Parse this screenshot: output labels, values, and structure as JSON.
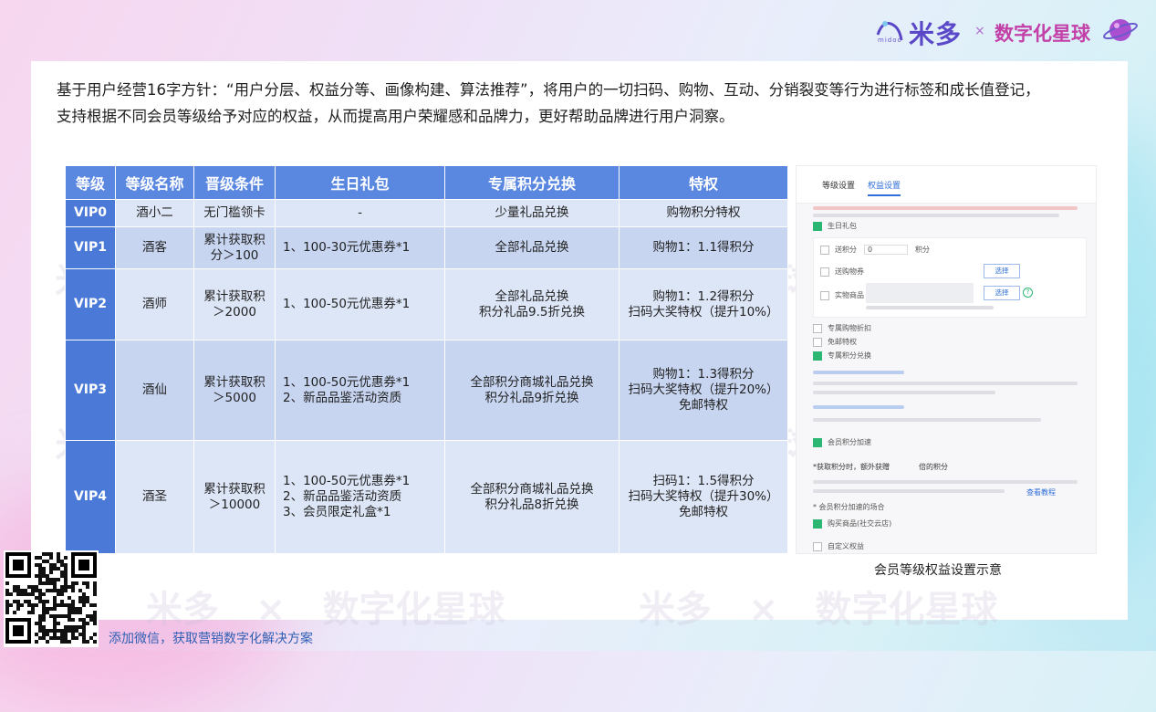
{
  "brand": {
    "logo_text": "米多",
    "logo_sub": "midoo",
    "separator": "×",
    "partner": "数字化星球"
  },
  "intro": {
    "line1": "基于用户经营16字方针：“用户分层、权益分等、画像构建、算法推荐”，将用户的一切扫码、购物、互动、分销裂变等行为进行标签和成长值登记，",
    "line2": "支持根据不同会员等级给予对应的权益，从而提高用户荣耀感和品牌力，更好帮助品牌进行用户洞察。"
  },
  "table": {
    "headers": [
      "等级",
      "等级名称",
      "晋级条件",
      "生日礼包",
      "专属积分兑换",
      "特权"
    ],
    "rows": [
      {
        "level": "VIP0",
        "name": "酒小二",
        "cond": [
          "无门槛领卡"
        ],
        "gift": [
          "-"
        ],
        "points": [
          "少量礼品兑换"
        ],
        "privilege": [
          "购物积分特权"
        ]
      },
      {
        "level": "VIP1",
        "name": "酒客",
        "cond": [
          "累计获取积",
          "分＞100"
        ],
        "gift": [
          "1、100-30元优惠券*1"
        ],
        "points": [
          "全部礼品兑换"
        ],
        "privilege": [
          "购物1：1.1得积分"
        ]
      },
      {
        "level": "VIP2",
        "name": "酒师",
        "cond": [
          "累计获取积",
          "＞2000"
        ],
        "gift": [
          "1、100-50元优惠券*1"
        ],
        "points": [
          "全部礼品兑换",
          "积分礼品9.5折兑换"
        ],
        "privilege": [
          "购物1：1.2得积分",
          "扫码大奖特权（提升10%）"
        ]
      },
      {
        "level": "VIP3",
        "name": "酒仙",
        "cond": [
          "累计获取积",
          "＞5000"
        ],
        "gift": [
          "1、100-50元优惠券*1",
          "2、新品品鉴活动资质"
        ],
        "points": [
          "全部积分商城礼品兑换",
          "积分礼品9折兑换"
        ],
        "privilege": [
          "购物1：1.3得积分",
          "扫码大奖特权（提升20%）",
          "免邮特权"
        ]
      },
      {
        "level": "VIP4",
        "name": "酒圣",
        "cond": [
          "累计获取积",
          "＞10000"
        ],
        "gift": [
          "1、100-50元优惠券*1",
          "2、新品品鉴活动资质",
          "3、会员限定礼盒*1"
        ],
        "points": [
          "全部积分商城礼品兑换",
          "积分礼品8折兑换"
        ],
        "privilege": [
          "扫码1：1.5得积分",
          "扫码大奖特权（提升30%）",
          "免邮特权"
        ]
      }
    ]
  },
  "panel": {
    "tab1": "等级设置",
    "tab2": "权益设置",
    "birthday": "生日礼包",
    "send_points": "送积分",
    "points_value": "0",
    "points_unit": "积分",
    "send_coupon": "送购物券",
    "physical": "实物商品",
    "select": "选择",
    "special_discount": "专属购物折扣",
    "free_shipping": "免邮特权",
    "exclusive_points": "专属积分兑换",
    "member_speed": "会员积分加速",
    "earn_label": "*获取积分时，额外获赠",
    "earn_suffix": "倍的积分",
    "method_label": "* 会员积分加速的场合",
    "buy_goods": "购买商品(社交云店)",
    "custom": "自定义权益",
    "view_tutorial": "查看教程"
  },
  "caption": "会员等级权益设置示意",
  "footer": "添加微信，获取营销数字化解决方案",
  "watermark": {
    "a": "米多",
    "b": "数字化星球"
  }
}
